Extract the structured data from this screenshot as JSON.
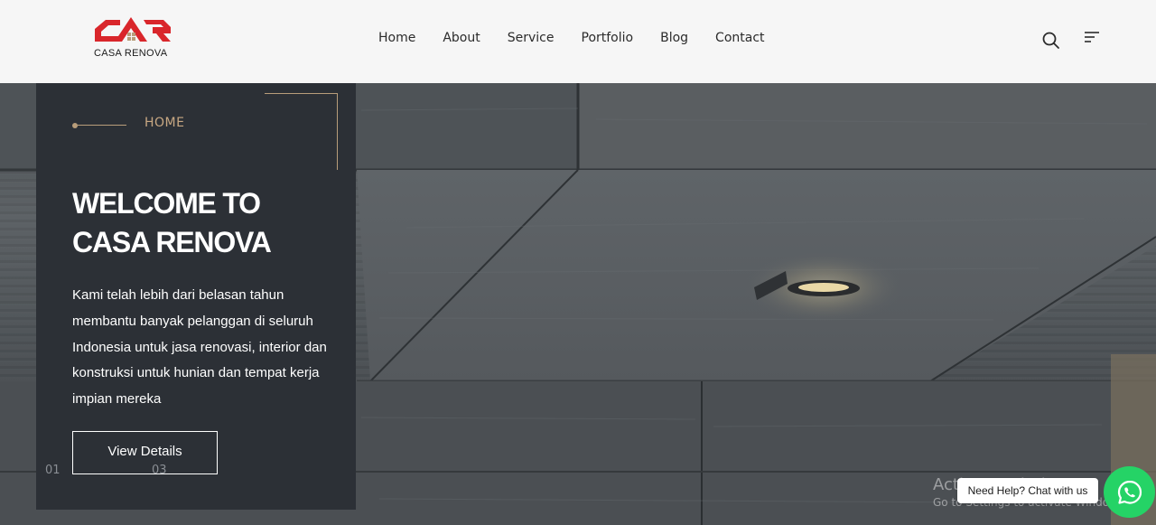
{
  "brand": {
    "name": "CASA RENOVA",
    "logo_color": "#d9262b"
  },
  "nav": {
    "items": [
      {
        "label": "Home"
      },
      {
        "label": "About"
      },
      {
        "label": "Service"
      },
      {
        "label": "Portfolio"
      },
      {
        "label": "Blog"
      },
      {
        "label": "Contact"
      }
    ]
  },
  "header_icons": {
    "search": "search-icon",
    "menu": "menu-lines-icon"
  },
  "hero": {
    "breadcrumb": "HOME",
    "title_line1": "WELCOME TO",
    "title_line2": "CASA RENOVA",
    "description": "Kami telah lebih dari belasan tahun membantu banyak pelanggan di seluruh Indonesia untuk jasa renovasi, interior dan konstruksi untuk hunian dan tempat kerja impian mereka",
    "button_label": "View Details",
    "slide_current": "01",
    "slide_total": "03",
    "accent_color": "#b89d7a"
  },
  "watermark": {
    "line1": "Activate Windows",
    "line2": "Go to Settings to activate Windows."
  },
  "chat": {
    "bubble_text": "Need Help? Chat with us",
    "icon": "whatsapp-icon",
    "color": "#25d366"
  }
}
